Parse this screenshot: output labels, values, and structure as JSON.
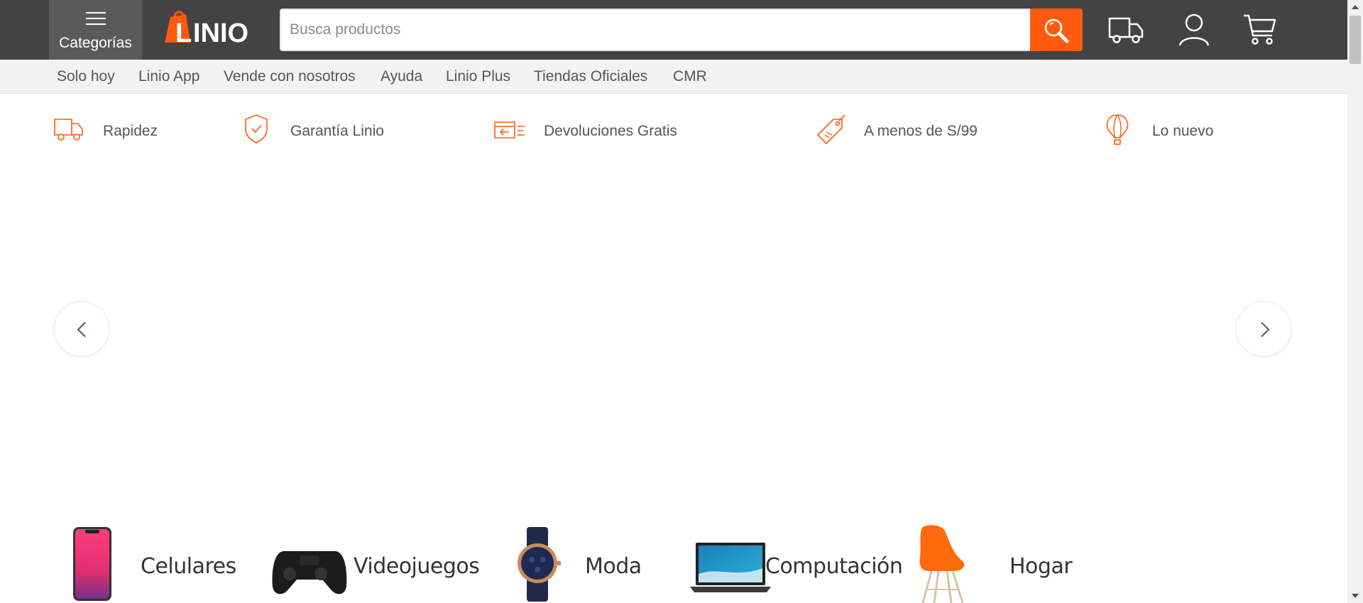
{
  "header": {
    "categories_label": "Categorías",
    "logo_text": "LINIO",
    "search": {
      "placeholder": "Busca productos",
      "value": ""
    }
  },
  "subnav": {
    "items": [
      "Solo hoy",
      "Linio App",
      "Vende con nosotros",
      "Ayuda",
      "Linio Plus",
      "Tiendas Oficiales",
      "CMR"
    ]
  },
  "benefits": {
    "items": [
      {
        "label": "Rapidez",
        "icon": "truck-icon"
      },
      {
        "label": "Garantía Linio",
        "icon": "shield-check-icon"
      },
      {
        "label": "Devoluciones Gratis",
        "icon": "return-box-icon"
      },
      {
        "label": "A menos de S/99",
        "icon": "price-tag-icon"
      },
      {
        "label": "Lo nuevo",
        "icon": "hot-air-balloon-icon"
      }
    ]
  },
  "categories": {
    "items": [
      {
        "label": "Celulares",
        "icon": "smartphone-icon"
      },
      {
        "label": "Videojuegos",
        "icon": "gamepad-icon"
      },
      {
        "label": "Moda",
        "icon": "wristwatch-icon"
      },
      {
        "label": "Computación",
        "icon": "laptop-icon"
      },
      {
        "label": "Hogar",
        "icon": "chair-icon"
      }
    ]
  },
  "colors": {
    "brand_orange": "#ff5a0f",
    "topbar": "#434343",
    "subnav_bg": "#f2f2f2"
  }
}
